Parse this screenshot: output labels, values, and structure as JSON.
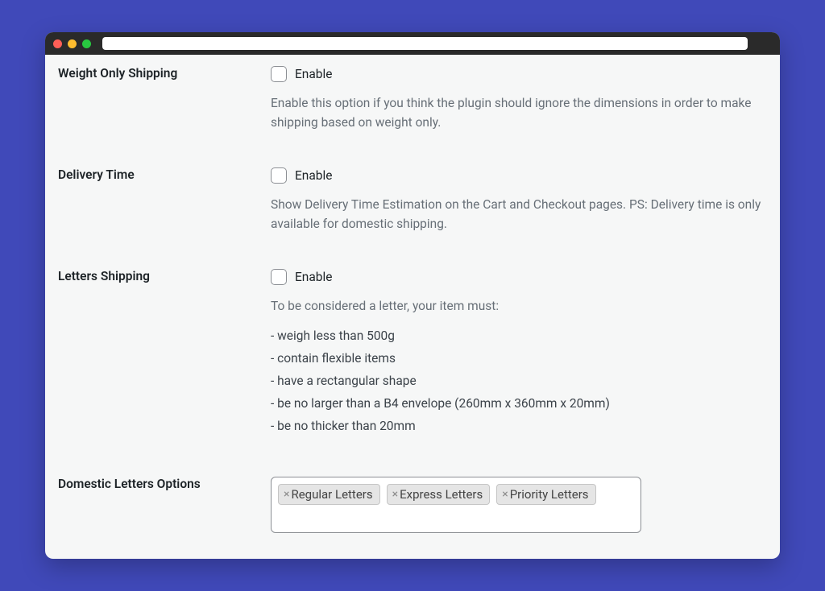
{
  "settings": {
    "weight_only": {
      "title": "Weight Only Shipping",
      "enable_label": "Enable",
      "desc": "Enable this option if you think the plugin should ignore the dimensions in order to make shipping based on weight only."
    },
    "delivery_time": {
      "title": "Delivery Time",
      "enable_label": "Enable",
      "desc": "Show Delivery Time Estimation on the Cart and Checkout pages. PS: Delivery time is only available for domestic shipping."
    },
    "letters": {
      "title": "Letters Shipping",
      "enable_label": "Enable",
      "intro": "To be considered a letter, your item must:",
      "items": [
        "- weigh less than 500g",
        "- contain flexible items",
        "- have a rectangular shape",
        "- be no larger than a B4 envelope (260mm x 360mm x 20mm)",
        "- be no thicker than 20mm"
      ]
    },
    "domestic_letters": {
      "title": "Domestic Letters Options",
      "tags": [
        "Regular Letters",
        "Express Letters",
        "Priority Letters"
      ]
    }
  }
}
